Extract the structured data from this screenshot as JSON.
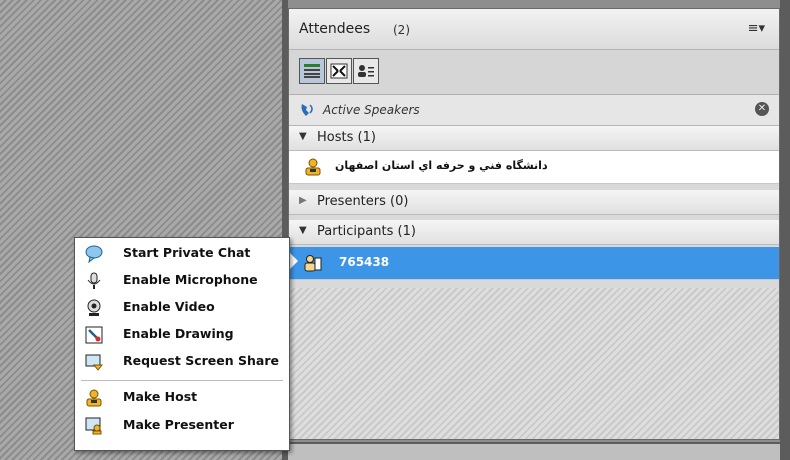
{
  "attendees": {
    "title": "Attendees",
    "count": "(2)",
    "menu_icon": "list-menu-icon"
  },
  "active_speakers": {
    "label": "Active Speakers"
  },
  "sections": {
    "hosts": "Hosts (1)",
    "presenters": "Presenters (0)",
    "participants": "Participants (1)"
  },
  "hosts": [
    {
      "name": "دانشگاه فني و حرفه اي استان اصفهان"
    }
  ],
  "participants": [
    {
      "name": "765438",
      "selected": true
    }
  ],
  "context_menu": {
    "items": [
      {
        "label": "Start Private Chat",
        "icon": "chat-icon"
      },
      {
        "label": "Enable Microphone",
        "icon": "microphone-icon"
      },
      {
        "label": "Enable Video",
        "icon": "webcam-icon"
      },
      {
        "label": "Enable Drawing",
        "icon": "drawing-icon"
      },
      {
        "label": "Request Screen Share",
        "icon": "screen-share-icon"
      },
      {
        "label": "Make Host",
        "icon": "host-icon"
      },
      {
        "label": "Make Presenter",
        "icon": "presenter-icon"
      }
    ]
  },
  "colors": {
    "selection": "#3d95e8",
    "accent": "#f0b429"
  }
}
